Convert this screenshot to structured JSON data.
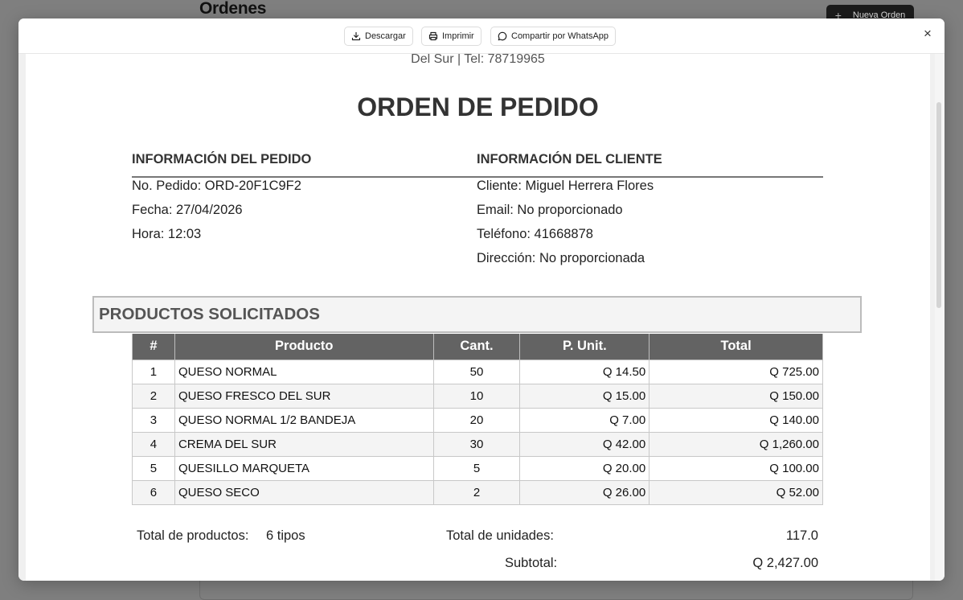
{
  "background": {
    "title": "Ordenes",
    "new_order_label": "Nueva Orden"
  },
  "toolbar": {
    "download_label": "Descargar",
    "print_label": "Imprimir",
    "whatsapp_label": "Compartir por WhatsApp",
    "close_glyph": "×"
  },
  "document": {
    "header_line": "Del Sur | Tel: 78719965",
    "title": "ORDEN DE PEDIDO",
    "order_info": {
      "heading": "INFORMACIÓN DEL PEDIDO",
      "order_no": "No. Pedido: ORD-20F1C9F2",
      "date": "Fecha: 27/04/2026",
      "time": "Hora: 12:03"
    },
    "client_info": {
      "heading": "INFORMACIÓN DEL CLIENTE",
      "client": "Cliente: Miguel Herrera Flores",
      "email": "Email: No proporcionado",
      "phone": "Teléfono: 41668878",
      "address": "Dirección: No proporcionada"
    },
    "products_heading": "PRODUCTOS SOLICITADOS",
    "table": {
      "headers": [
        "#",
        "Producto",
        "Cant.",
        "P. Unit.",
        "Total"
      ],
      "rows": [
        [
          "1",
          "QUESO NORMAL",
          "50",
          "Q 14.50",
          "Q 725.00"
        ],
        [
          "2",
          "QUESO FRESCO DEL SUR",
          "10",
          "Q 15.00",
          "Q 150.00"
        ],
        [
          "3",
          "QUESO NORMAL 1/2 BANDEJA",
          "20",
          "Q 7.00",
          "Q 140.00"
        ],
        [
          "4",
          "CREMA DEL SUR",
          "30",
          "Q 42.00",
          "Q 1,260.00"
        ],
        [
          "5",
          "QUESILLO MARQUETA",
          "5",
          "Q 20.00",
          "Q 100.00"
        ],
        [
          "6",
          "QUESO SECO",
          "2",
          "Q 26.00",
          "Q 52.00"
        ]
      ]
    },
    "totals": {
      "products_label": "Total de productos:",
      "products_value": "6 tipos",
      "units_label": "Total de unidades:",
      "units_value": "117.0",
      "subtotal_label": "Subtotal:",
      "subtotal_value": "Q 2,427.00"
    }
  }
}
